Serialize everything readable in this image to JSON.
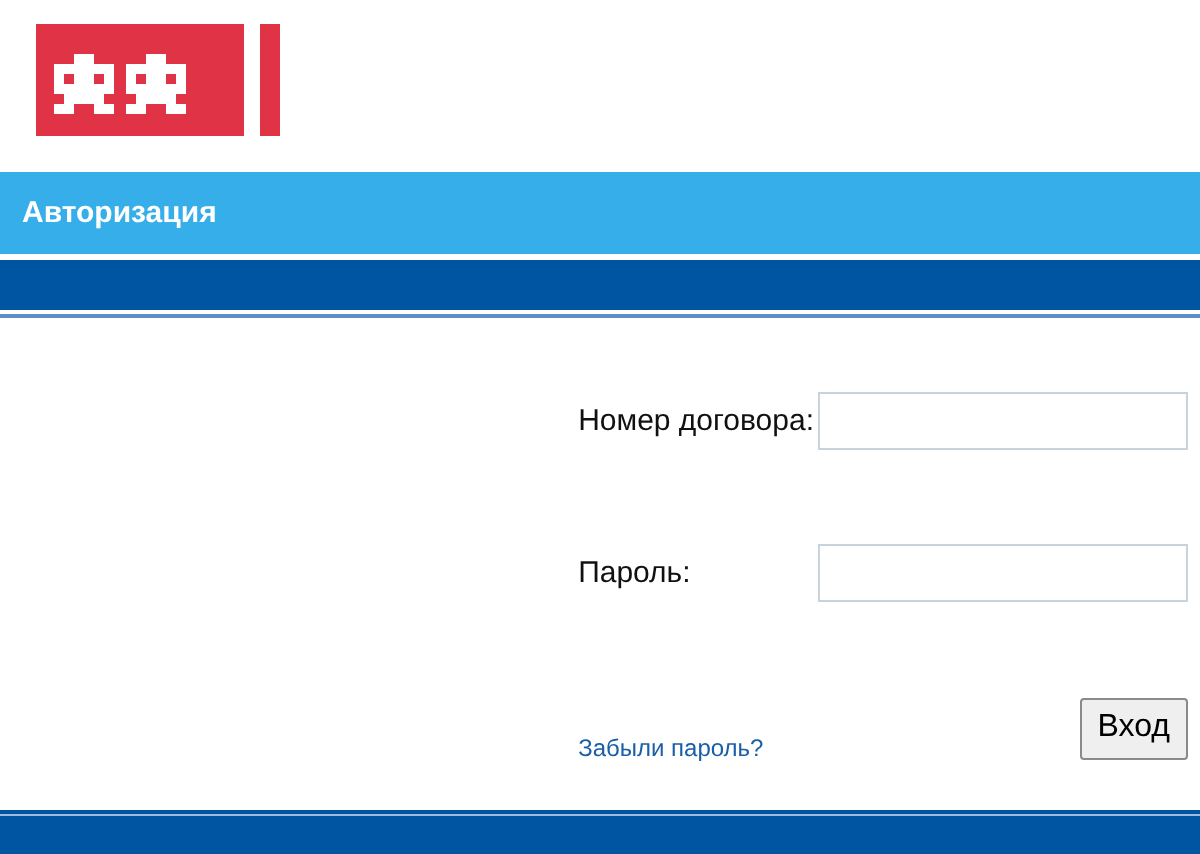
{
  "header": {
    "title": "Авторизация"
  },
  "form": {
    "fields": [
      {
        "label": "Номер договора:"
      },
      {
        "label": "Пароль:"
      }
    ],
    "forgot_link": "Забыли пароль?",
    "submit": "Вход"
  }
}
